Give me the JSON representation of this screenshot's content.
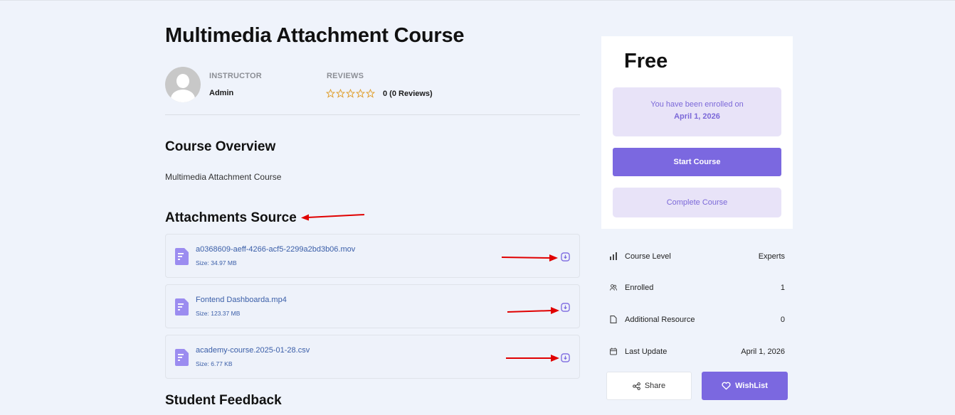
{
  "course": {
    "title": "Multimedia Attachment Course",
    "instructor_label": "INSTRUCTOR",
    "instructor_name": "Admin",
    "reviews_label": "REVIEWS",
    "reviews_value": "0 (0 Reviews)",
    "rating": 0
  },
  "overview": {
    "heading": "Course Overview",
    "text": "Multimedia Attachment Course"
  },
  "attachments": {
    "heading": "Attachments Source",
    "items": [
      {
        "name": "a0368609-aeff-4266-acf5-2299a2bd3b06.mov",
        "size": "Size: 34.97 MB"
      },
      {
        "name": "Fontend Dashboarda.mp4",
        "size": "Size: 123.37 MB"
      },
      {
        "name": "academy-course.2025-01-28.csv",
        "size": "Size: 6.77 KB"
      }
    ]
  },
  "feedback": {
    "heading": "Student Feedback"
  },
  "sidebar": {
    "price": "Free",
    "enrolled_text": "You have been enrolled on",
    "enrolled_date": "April 1, 2026",
    "start_label": "Start Course",
    "complete_label": "Complete Course",
    "info": [
      {
        "icon": "bar-chart-icon",
        "label": "Course Level",
        "value": "Experts"
      },
      {
        "icon": "users-icon",
        "label": "Enrolled",
        "value": "1"
      },
      {
        "icon": "document-icon",
        "label": "Additional Resource",
        "value": "0"
      },
      {
        "icon": "calendar-icon",
        "label": "Last Update",
        "value": "April 1, 2026"
      }
    ],
    "share_label": "Share",
    "wishlist_label": "WishList"
  },
  "colors": {
    "accent": "#7b68e0",
    "accent_light": "#e8e3f8",
    "background": "#eff3fb",
    "link": "#3a5ea8",
    "annotation_arrow": "#e00000"
  }
}
